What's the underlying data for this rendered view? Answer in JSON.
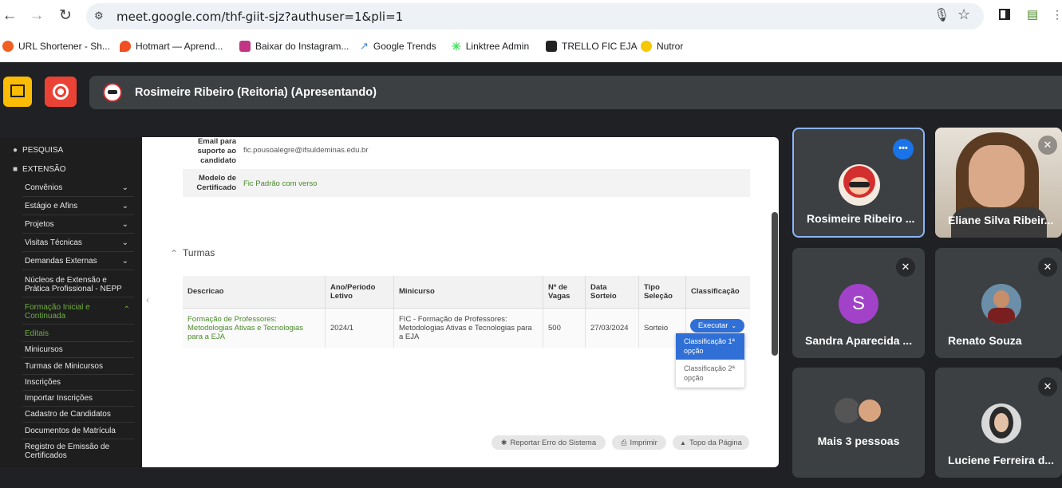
{
  "browser": {
    "url": "meet.google.com/thf-giit-sjz?authuser=1&pli=1",
    "bookmarks": [
      {
        "label": "URL Shortener - Sh...",
        "icon": "bitly-icon",
        "color": "#ee6123"
      },
      {
        "label": "Hotmart — Aprend...",
        "icon": "hotmart-flame-icon",
        "color": "#f04e23"
      },
      {
        "label": "Baixar do Instagram...",
        "icon": "instagram-download-icon",
        "color": "#c13584"
      },
      {
        "label": "Google Trends",
        "icon": "trends-icon",
        "color": "#4285f4"
      },
      {
        "label": "Linktree Admin",
        "icon": "linktree-icon",
        "color": "#43e55e"
      },
      {
        "label": "TRELLO FIC EJA",
        "icon": "trello-icon",
        "color": "#222222"
      },
      {
        "label": "Nutror",
        "icon": "nutror-icon",
        "color": "#1a1a1a"
      }
    ]
  },
  "meet": {
    "presenting_title": "Rosimeire Ribeiro (Reitoria) (Apresentando)",
    "tiles": [
      {
        "name": "Rosimeire Ribeiro ...",
        "muted": false
      },
      {
        "name": "Eliane Silva Ribeir...",
        "muted": true
      },
      {
        "name": "Sandra Aparecida ...",
        "muted": true,
        "initial": "S",
        "avatar_color": "#a142c8"
      },
      {
        "name": "Renato Souza",
        "muted": true
      },
      {
        "name": "Mais 3 pessoas",
        "muted": false
      },
      {
        "name": "Luciene Ferreira d...",
        "muted": true
      }
    ],
    "more_options_glyph": "•••"
  },
  "sidebar": {
    "pesquisa": "PESQUISA",
    "extensao": "EXTENSÃO",
    "items": [
      "Convênios",
      "Estágio e Afins",
      "Projetos",
      "Visitas Técnicas",
      "Demandas Externas",
      "Núcleos de Extensão e Prática Profissional - NEPP",
      "Formação Inicial e Continuada",
      "Editais",
      "Minicursos",
      "Turmas de Minicursos",
      "Inscrições",
      "Importar Inscrições",
      "Cadastro de Candidatos",
      "Documentos de Matrícula",
      "Registro de Emissão de Certificados"
    ]
  },
  "page": {
    "email_label": "Email para suporte ao candidato",
    "email_value": "fic.pousoalegre@ifsuldeminas.edu.br",
    "modelo_label": "Modelo de Certificado",
    "modelo_value": "Fic Padrão com verso",
    "turmas_title": "Turmas",
    "table": {
      "headers": [
        "Descricao",
        "Ano/Período Letivo",
        "Minicurso",
        "Nº de Vagas",
        "Data Sorteio",
        "Tipo Seleção",
        "Classificação"
      ],
      "row": {
        "descricao": "Formação de Professores: Metodologias Ativas e Tecnologias para a EJA",
        "ano": "2024/1",
        "minicurso": "FIC - Formação de Professores: Metodologias Ativas e Tecnologias para a EJA",
        "vagas": "500",
        "data": "27/03/2024",
        "tipo": "Sorteio"
      }
    },
    "executar_label": "Executar",
    "dropdown": [
      "Classificação 1ª opção",
      "Classificação 2ª opção"
    ],
    "footer_buttons": [
      "Reportar Erro do Sistema",
      "Imprimir",
      "Topo da Página"
    ]
  }
}
